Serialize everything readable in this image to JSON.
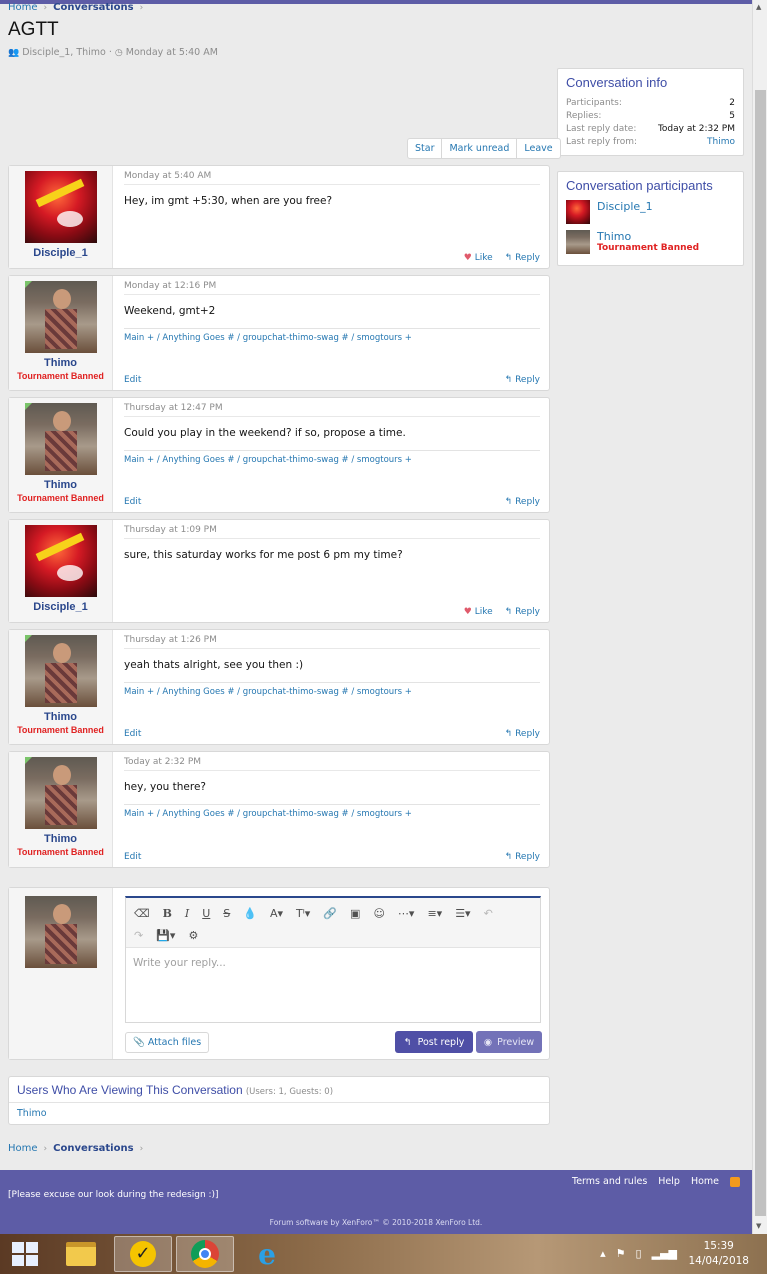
{
  "breadcrumb": {
    "home": "Home",
    "current": "Conversations",
    "sep": "›"
  },
  "title": "AGTT",
  "meta": {
    "participants": "Disciple_1, Thimo",
    "sep": "·",
    "date": "Monday at 5:40 AM"
  },
  "actions": {
    "star": "Star",
    "mark_unread": "Mark unread",
    "leave": "Leave"
  },
  "info": {
    "heading": "Conversation info",
    "rows": [
      {
        "k": "Participants:",
        "v": "2"
      },
      {
        "k": "Replies:",
        "v": "5"
      },
      {
        "k": "Last reply date:",
        "v": "Today at 2:32 PM"
      },
      {
        "k": "Last reply from:",
        "v": "Thimo"
      }
    ]
  },
  "participants_box": {
    "heading": "Conversation participants",
    "items": [
      {
        "name": "Disciple_1",
        "banned": ""
      },
      {
        "name": "Thimo",
        "banned": "Tournament Banned"
      }
    ]
  },
  "messages": [
    {
      "author": "Disciple_1",
      "banned": "",
      "date": "Monday at 5:40 AM",
      "text": "Hey, im gmt +5:30, when are you free?",
      "signature": "",
      "edit": "",
      "like": "Like",
      "reply": "Reply"
    },
    {
      "author": "Thimo",
      "banned": "Tournament Banned",
      "date": "Monday at 12:16 PM",
      "text": "Weekend, gmt+2",
      "signature": "Main + / Anything Goes # / groupchat-thimo-swag # / smogtours +",
      "edit": "Edit",
      "like": "",
      "reply": "Reply"
    },
    {
      "author": "Thimo",
      "banned": "Tournament Banned",
      "date": "Thursday at 12:47 PM",
      "text": "Could you play in the weekend? if so, propose a time.",
      "signature": "Main + / Anything Goes # / groupchat-thimo-swag # / smogtours +",
      "edit": "Edit",
      "like": "",
      "reply": "Reply"
    },
    {
      "author": "Disciple_1",
      "banned": "",
      "date": "Thursday at 1:09 PM",
      "text": "sure, this saturday works for me post 6 pm my time?",
      "signature": "",
      "edit": "",
      "like": "Like",
      "reply": "Reply"
    },
    {
      "author": "Thimo",
      "banned": "Tournament Banned",
      "date": "Thursday at 1:26 PM",
      "text": "yeah thats alright, see you then :)",
      "signature": "Main + / Anything Goes # / groupchat-thimo-swag # / smogtours +",
      "edit": "Edit",
      "like": "",
      "reply": "Reply"
    },
    {
      "author": "Thimo",
      "banned": "Tournament Banned",
      "date": "Today at 2:32 PM",
      "text": "hey, you there?",
      "signature": "Main + / Anything Goes # / groupchat-thimo-swag # / smogtours +",
      "edit": "Edit",
      "like": "",
      "reply": "Reply"
    }
  ],
  "editor": {
    "placeholder": "Write your reply...",
    "attach": "Attach files",
    "post": "Post reply",
    "preview": "Preview",
    "toolbar_row1": [
      "eraser-icon",
      "bold-icon",
      "italic-icon",
      "underline-icon",
      "strike-icon",
      "color-icon",
      "font-size-icon",
      "text-style-icon",
      "link-icon",
      "image-icon",
      "smilie-icon",
      "more-icon",
      "align-icon",
      "list-icon",
      "undo-icon"
    ],
    "toolbar_row2": [
      "redo-icon",
      "drafts-icon",
      "settings-icon"
    ]
  },
  "viewing": {
    "title": "Users Who Are Viewing This Conversation",
    "count": "(Users: 1, Guests: 0)",
    "users": "Thimo"
  },
  "footer": {
    "terms": "Terms and rules",
    "help": "Help",
    "home": "Home",
    "note": "[Please excuse our look during the redesign :)]",
    "copyright": "Forum software by XenForo™ © 2010-2018 XenForo Ltd."
  },
  "taskbar": {
    "time": "15:39",
    "date": "14/04/2018"
  },
  "colors": {
    "accent": "#5d5ca6",
    "link": "#2577b1",
    "banned": "#e02222"
  }
}
